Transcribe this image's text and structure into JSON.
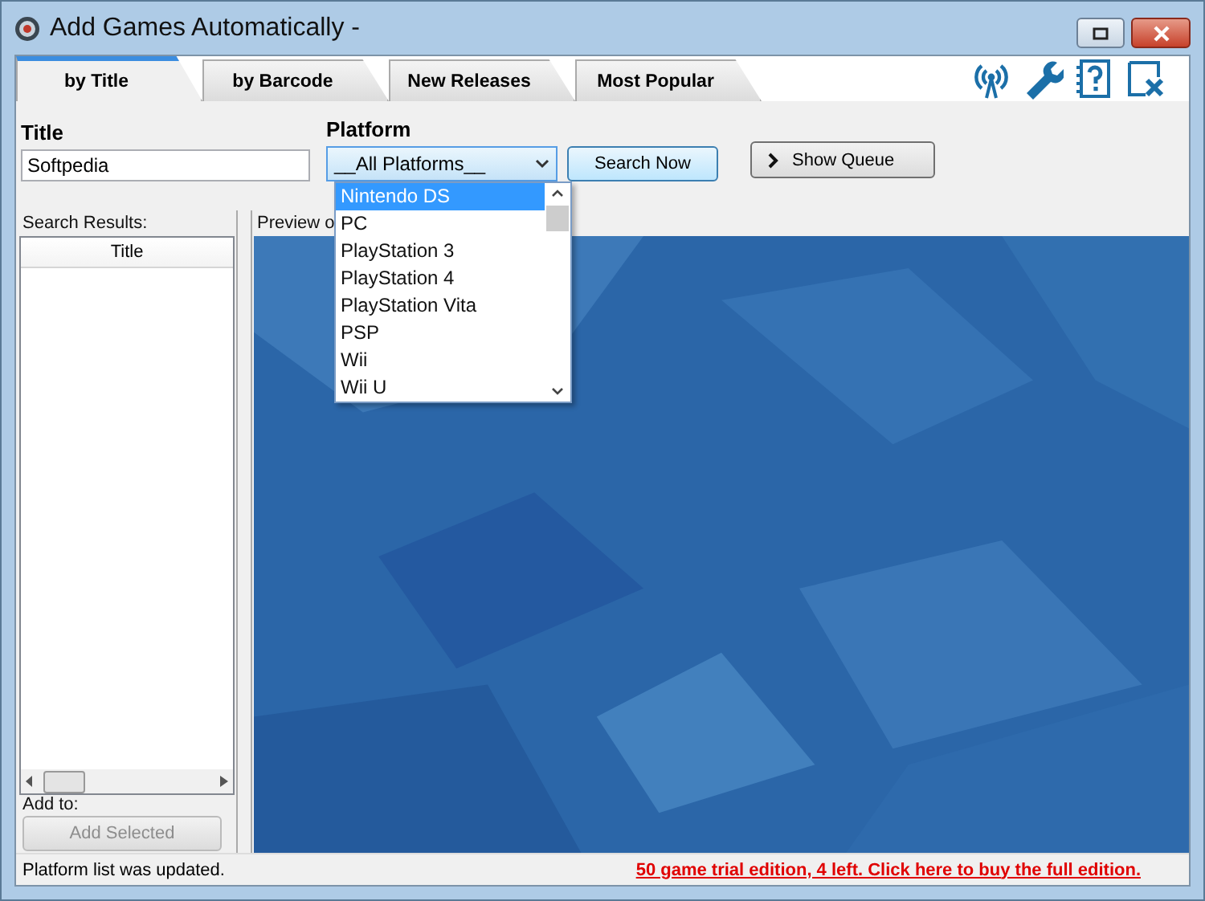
{
  "window": {
    "title": "Add Games Automatically -"
  },
  "tabs": [
    {
      "label": "by Title",
      "selected": true
    },
    {
      "label": "by Barcode",
      "selected": false
    },
    {
      "label": "New Releases",
      "selected": false
    },
    {
      "label": "Most Popular",
      "selected": false
    }
  ],
  "form": {
    "title_label": "Title",
    "title_value": "Softpedia",
    "platform_label": "Platform",
    "platform_value": "__All Platforms__",
    "search_button": "Search Now",
    "queue_button": "Show Queue"
  },
  "platform_list": [
    {
      "label": "Nintendo DS",
      "selected": true
    },
    {
      "label": "PC",
      "selected": false
    },
    {
      "label": "PlayStation 3",
      "selected": false
    },
    {
      "label": "PlayStation 4",
      "selected": false
    },
    {
      "label": "PlayStation Vita",
      "selected": false
    },
    {
      "label": "PSP",
      "selected": false
    },
    {
      "label": "Wii",
      "selected": false
    },
    {
      "label": "Wii U",
      "selected": false
    }
  ],
  "results": {
    "label": "Search Results:",
    "column": "Title",
    "add_to_label": "Add to:",
    "add_button": "Add Selected",
    "add_disabled": true
  },
  "preview": {
    "label": "Preview o",
    "kind": "picture"
  },
  "status_bar": {
    "message": "Platform list was updated.",
    "trial_link": "50 game trial edition, 4 left. Click here to buy the full edition."
  }
}
